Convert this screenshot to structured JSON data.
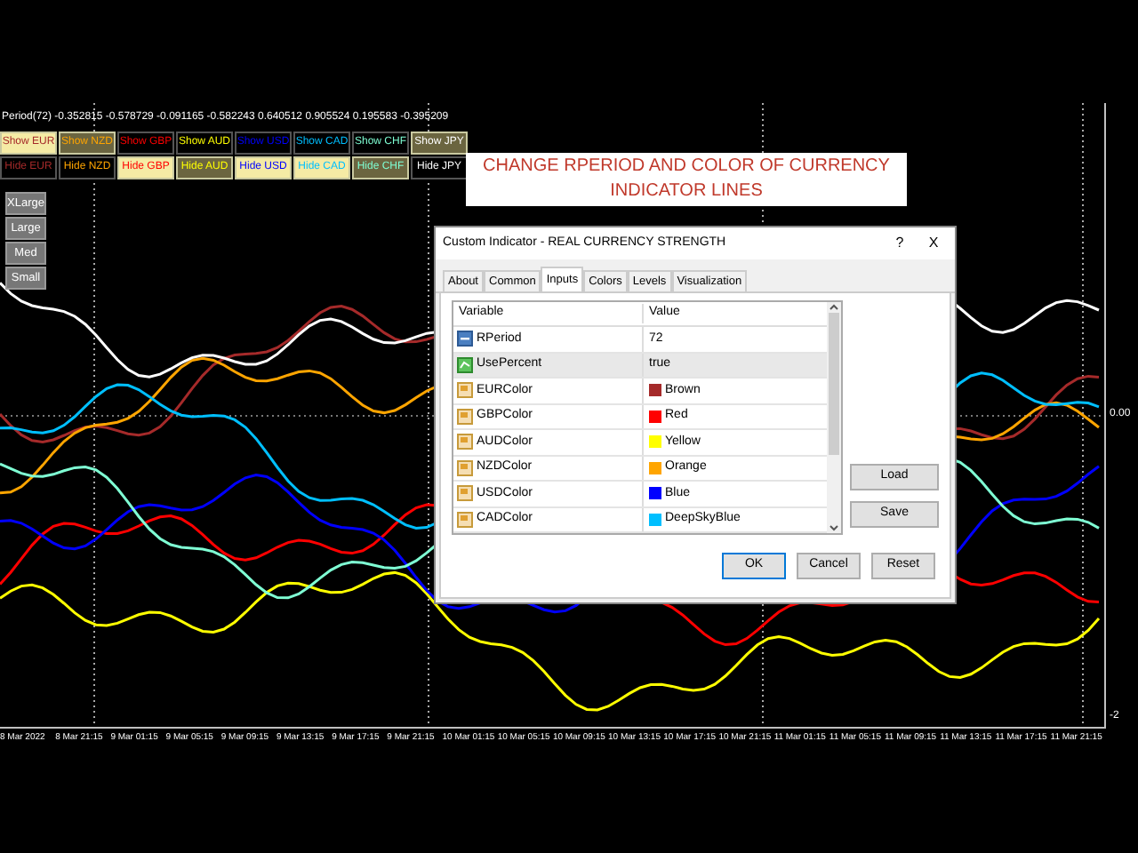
{
  "period_readout": "Period(72) -0.352815 -0.578729 -0.091165 -0.582243 0.640512 0.905524 0.195583 -0.395209",
  "currencies": [
    {
      "color": "#a52a2a",
      "show": {
        "label": "Show EUR",
        "selected": true
      },
      "hide": {
        "label": "Hide EUR",
        "selected": false
      }
    },
    {
      "color": "#ffa500",
      "show": {
        "label": "Show NZD",
        "selected": true
      },
      "hide": {
        "label": "Hide NZD",
        "selected": false
      }
    },
    {
      "color": "#ff0000",
      "show": {
        "label": "Show GBP",
        "selected": false
      },
      "hide": {
        "label": "Hide GBP",
        "selected": true
      }
    },
    {
      "color": "#ffff00",
      "show": {
        "label": "Show AUD",
        "selected": false
      },
      "hide": {
        "label": "Hide AUD",
        "selected": true
      }
    },
    {
      "color": "#0000ff",
      "show": {
        "label": "Show USD",
        "selected": false
      },
      "hide": {
        "label": "Hide USD",
        "selected": true
      }
    },
    {
      "color": "#00bfff",
      "show": {
        "label": "Show CAD",
        "selected": false
      },
      "hide": {
        "label": "Hide CAD",
        "selected": true
      }
    },
    {
      "color": "#7fffd4",
      "show": {
        "label": "Show CHF",
        "selected": false
      },
      "hide": {
        "label": "Hide CHF",
        "selected": true
      }
    },
    {
      "color": "#ffffff",
      "show": {
        "label": "Show JPY",
        "selected": true
      },
      "hide": {
        "label": "Hide JPY",
        "selected": false
      }
    }
  ],
  "size_buttons": [
    "XLarge",
    "Large",
    "Med",
    "Small"
  ],
  "banner": "CHANGE RPERIOD AND COLOR OF CURRENCY INDICATOR LINES",
  "dialog": {
    "title": "Custom Indicator - REAL CURRENCY STRENGTH",
    "help": "?",
    "close": "X",
    "tabs": [
      {
        "label": "About",
        "selected": false
      },
      {
        "label": "Common",
        "selected": false
      },
      {
        "label": "Inputs",
        "selected": true
      },
      {
        "label": "Colors",
        "selected": false
      },
      {
        "label": "Levels",
        "selected": false
      },
      {
        "label": "Visualization",
        "selected": false
      }
    ],
    "table": {
      "columns": [
        "Variable",
        "Value"
      ],
      "rows": [
        {
          "kind": "int",
          "variable": "RPeriod",
          "value": "72",
          "selected": false
        },
        {
          "kind": "bool",
          "variable": "UsePercent",
          "value": "true",
          "selected": true
        },
        {
          "kind": "color",
          "variable": "EURColor",
          "value": "Brown",
          "color": "#a52a2a",
          "selected": false
        },
        {
          "kind": "color",
          "variable": "GBPColor",
          "value": "Red",
          "color": "#ff0000",
          "selected": false
        },
        {
          "kind": "color",
          "variable": "AUDColor",
          "value": "Yellow",
          "color": "#ffff00",
          "selected": false
        },
        {
          "kind": "color",
          "variable": "NZDColor",
          "value": "Orange",
          "color": "#ffa500",
          "selected": false
        },
        {
          "kind": "color",
          "variable": "USDColor",
          "value": "Blue",
          "color": "#0000ff",
          "selected": false
        },
        {
          "kind": "color",
          "variable": "CADColor",
          "value": "DeepSkyBlue",
          "color": "#00bfff",
          "selected": false
        }
      ]
    },
    "side_buttons": [
      "Load",
      "Save"
    ],
    "buttons": [
      "OK",
      "Cancel",
      "Reset"
    ]
  },
  "y_axis": [
    "0.00",
    "-2"
  ],
  "x_axis": [
    "8 Mar 2022",
    "8 Mar 21:15",
    "9 Mar 01:15",
    "9 Mar 05:15",
    "9 Mar 09:15",
    "9 Mar 13:15",
    "9 Mar 17:15",
    "9 Mar 21:15",
    "10 Mar 01:15",
    "10 Mar 05:15",
    "10 Mar 09:15",
    "10 Mar 13:15",
    "10 Mar 17:15",
    "10 Mar 21:15",
    "11 Mar 01:15",
    "11 Mar 05:15",
    "11 Mar 09:15",
    "11 Mar 13:15",
    "11 Mar 17:15",
    "11 Mar 21:15"
  ]
}
